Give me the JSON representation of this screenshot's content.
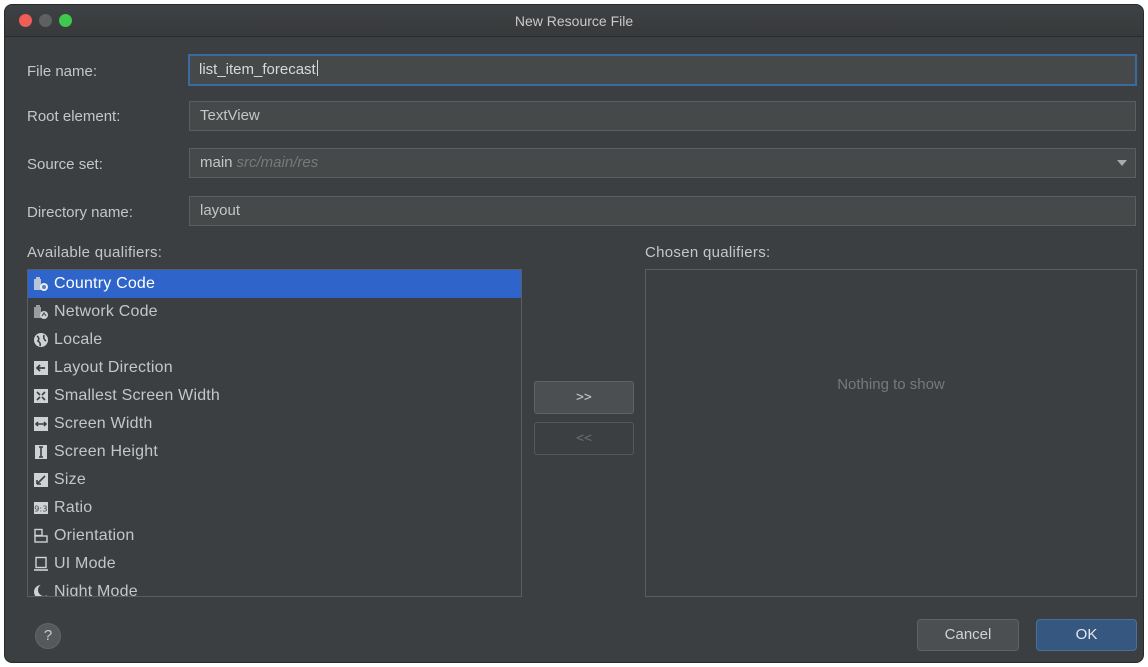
{
  "window": {
    "title": "New Resource File"
  },
  "form": {
    "file_name": {
      "label": "File name:",
      "value": "list_item_forecast"
    },
    "root_element": {
      "label": "Root element:",
      "value": "TextView"
    },
    "source_set": {
      "label": "Source set:",
      "value": "main",
      "hint": "src/main/res"
    },
    "directory_name": {
      "label": "Directory name:",
      "value": "layout"
    }
  },
  "qualifiers": {
    "available_label": "Available qualifiers:",
    "chosen_label": "Chosen qualifiers:",
    "chosen_empty": "Nothing to show",
    "add_label": ">>",
    "remove_label": "<<",
    "items": [
      {
        "label": "Country Code",
        "icon": "country-code-icon",
        "selected": true
      },
      {
        "label": "Network Code",
        "icon": "network-code-icon"
      },
      {
        "label": "Locale",
        "icon": "globe-icon"
      },
      {
        "label": "Layout Direction",
        "icon": "layout-direction-icon"
      },
      {
        "label": "Smallest Screen Width",
        "icon": "smallest-width-icon"
      },
      {
        "label": "Screen Width",
        "icon": "screen-width-icon"
      },
      {
        "label": "Screen Height",
        "icon": "screen-height-icon"
      },
      {
        "label": "Size",
        "icon": "size-icon"
      },
      {
        "label": "Ratio",
        "icon": "ratio-icon"
      },
      {
        "label": "Orientation",
        "icon": "orientation-icon"
      },
      {
        "label": "UI Mode",
        "icon": "ui-mode-icon"
      },
      {
        "label": "Night Mode",
        "icon": "night-mode-icon"
      }
    ]
  },
  "buttons": {
    "help": "?",
    "cancel": "Cancel",
    "ok": "OK"
  },
  "colors": {
    "selection": "#2f65ca",
    "focus_border": "#3b6aa0",
    "ok_button": "#365880"
  }
}
